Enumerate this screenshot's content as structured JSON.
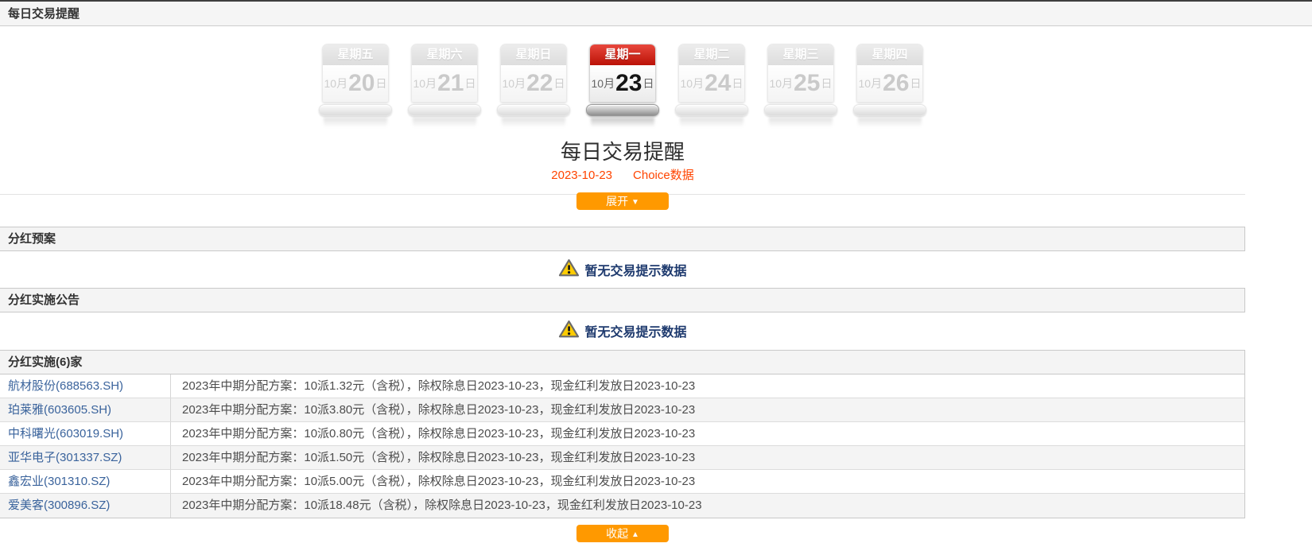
{
  "page": {
    "header_title": "每日交易提醒"
  },
  "calendar": {
    "active_index": 3,
    "days": [
      {
        "weekday": "星期五",
        "month": "10月",
        "day": "20",
        "day_suffix": "日"
      },
      {
        "weekday": "星期六",
        "month": "10月",
        "day": "21",
        "day_suffix": "日"
      },
      {
        "weekday": "星期日",
        "month": "10月",
        "day": "22",
        "day_suffix": "日"
      },
      {
        "weekday": "星期一",
        "month": "10月",
        "day": "23",
        "day_suffix": "日"
      },
      {
        "weekday": "星期二",
        "month": "10月",
        "day": "24",
        "day_suffix": "日"
      },
      {
        "weekday": "星期三",
        "month": "10月",
        "day": "25",
        "day_suffix": "日"
      },
      {
        "weekday": "星期四",
        "month": "10月",
        "day": "26",
        "day_suffix": "日"
      }
    ]
  },
  "summary": {
    "title": "每日交易提醒",
    "date": "2023-10-23",
    "source": "Choice数据"
  },
  "controls": {
    "expand_label": "展开",
    "expand_icon": "▼",
    "collapse_label": "收起",
    "collapse_icon": "▲"
  },
  "sections": {
    "dividend_plan": {
      "title": "分红预案"
    },
    "dividend_announcement": {
      "title": "分红实施公告"
    },
    "dividend_implementation": {
      "title": "分红实施(6)家"
    }
  },
  "empty_notice": {
    "text": "暂无交易提示数据"
  },
  "dividend_rows": [
    {
      "stock": "航材股份(688563.SH)",
      "detail": "2023年中期分配方案：10派1.32元（含税），除权除息日2023-10-23，现金红利发放日2023-10-23"
    },
    {
      "stock": "珀莱雅(603605.SH)",
      "detail": "2023年中期分配方案：10派3.80元（含税），除权除息日2023-10-23，现金红利发放日2023-10-23"
    },
    {
      "stock": "中科曙光(603019.SH)",
      "detail": "2023年中期分配方案：10派0.80元（含税），除权除息日2023-10-23，现金红利发放日2023-10-23"
    },
    {
      "stock": "亚华电子(301337.SZ)",
      "detail": "2023年中期分配方案：10派1.50元（含税），除权除息日2023-10-23，现金红利发放日2023-10-23"
    },
    {
      "stock": "鑫宏业(301310.SZ)",
      "detail": "2023年中期分配方案：10派5.00元（含税），除权除息日2023-10-23，现金红利发放日2023-10-23"
    },
    {
      "stock": "爱美客(300896.SZ)",
      "detail": "2023年中期分配方案：10派18.48元（含税），除权除息日2023-10-23，现金红利发放日2023-10-23"
    }
  ],
  "colors": {
    "accent_orange": "#ff9900",
    "active_red": "#c11a0f",
    "link_blue": "#3a639c",
    "notice_navy": "#1e3a6e",
    "subtitle_red": "#ff4400",
    "warning_yellow": "#ffcc00"
  }
}
